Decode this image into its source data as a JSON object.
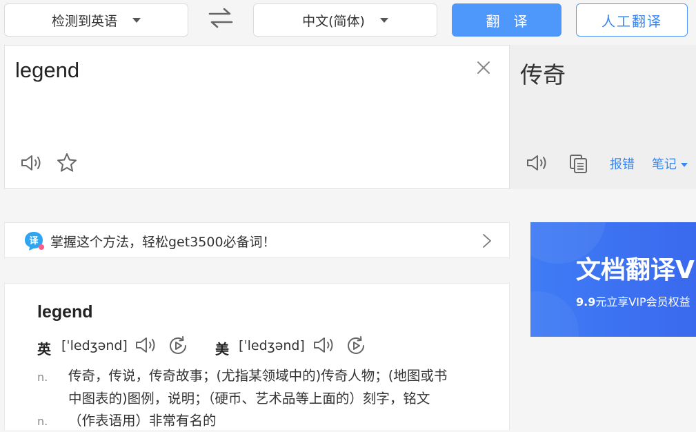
{
  "toolbar": {
    "source_lang": "检测到英语",
    "target_lang": "中文(简体)",
    "translate_label": "翻译",
    "human_translate_label": "人工翻译"
  },
  "input": {
    "text": "legend"
  },
  "output": {
    "text": "传奇",
    "report_label": "报错",
    "notes_label": "笔记"
  },
  "promo": {
    "icon_text": "译",
    "text": "掌握这个方法，轻松get3500必备词！"
  },
  "ad": {
    "title": "文档翻译V",
    "price": "9.9",
    "subtitle": "元立享VIP会员权益"
  },
  "dict": {
    "word": "legend",
    "uk_label": "英",
    "uk_phonetic": "[ˈledʒənd]",
    "us_label": "美",
    "us_phonetic": "[ˈledʒənd]",
    "definitions": [
      {
        "pos": "n.",
        "line1": "传奇，传说，传奇故事；(尤指某领域中的)传奇人物；(地图或书",
        "line2": "中图表的)图例，说明；（硬币、艺术品等上面的）刻字，铭文"
      },
      {
        "pos": "n.",
        "line1": "（作表语用）非常有名的"
      }
    ]
  },
  "colors": {
    "accent": "#4e97fb",
    "link": "#3a87f2",
    "ad_bg": "#3f7cf5"
  }
}
